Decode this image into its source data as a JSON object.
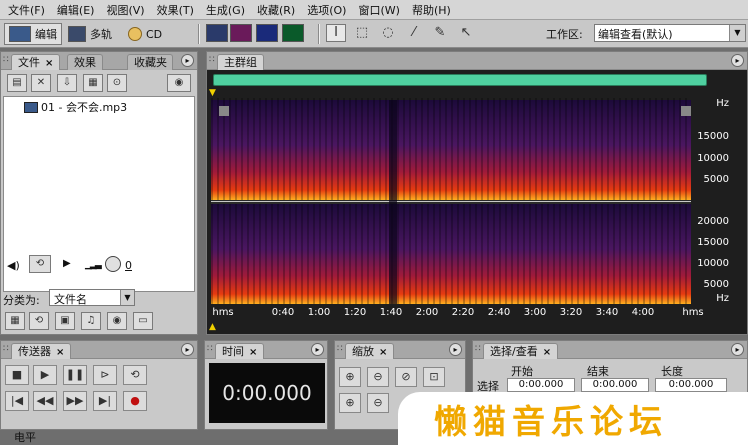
{
  "menu": [
    "文件(F)",
    "编辑(E)",
    "视图(V)",
    "效果(T)",
    "生成(G)",
    "收藏(R)",
    "选项(O)",
    "窗口(W)",
    "帮助(H)"
  ],
  "toolbar": {
    "modes": [
      "编辑",
      "多轨",
      "CD"
    ],
    "workspace_label": "工作区:",
    "workspace_value": "编辑查看(默认)"
  },
  "files_panel": {
    "tabs": [
      "文件",
      "效果",
      "收藏夹"
    ],
    "close_mark": "×",
    "file_name": "01 - 会不会.mp3",
    "volume_value": "0",
    "sort_label": "分类为:",
    "sort_value": "文件名"
  },
  "main_group": {
    "tab": "主群组",
    "hz_top": [
      "Hz",
      "15000",
      "10000",
      "5000"
    ],
    "hz_bottom": [
      "20000",
      "15000",
      "10000",
      "5000",
      "Hz"
    ],
    "time_labels": [
      "hms",
      "0:40",
      "1:00",
      "1:20",
      "1:40",
      "2:00",
      "2:20",
      "2:40",
      "3:00",
      "3:20",
      "3:40",
      "4:00",
      "hms"
    ]
  },
  "transport": {
    "tab": "传送器"
  },
  "time_panel": {
    "tab": "时间",
    "value": "0:00.000"
  },
  "zoom_panel": {
    "tab": "缩放"
  },
  "selection_panel": {
    "tab": "选择/查看",
    "headers": [
      "开始",
      "结束",
      "长度"
    ],
    "row_label": "选择",
    "values": [
      "0:00.000",
      "0:00.000",
      "0:00.000"
    ]
  },
  "level_tab": "电平",
  "watermark": "懒猫音乐论坛",
  "colors": {
    "overview": "#4fd0a0",
    "spectral_bg": "#1a0a2a",
    "accent": "#f0a800"
  }
}
